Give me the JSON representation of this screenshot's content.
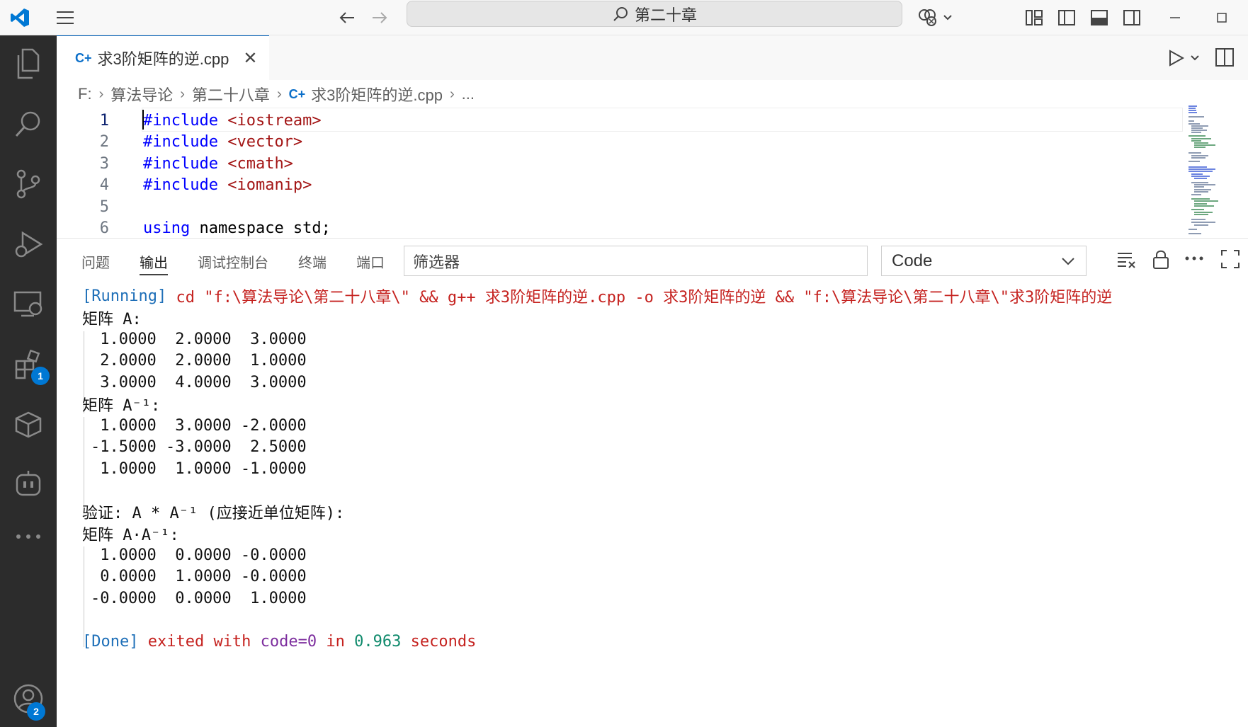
{
  "titlebar": {
    "search_text": "第二十章"
  },
  "tabs": {
    "active_file": "求3阶矩阵的逆.cpp",
    "close_glyph": "✕"
  },
  "breadcrumb": {
    "items": [
      "F:",
      "算法导论",
      "第二十八章",
      "求3阶矩阵的逆.cpp",
      "..."
    ]
  },
  "editor": {
    "lines": [
      {
        "num": "1",
        "kw": "#include",
        "rest": " <iostream>"
      },
      {
        "num": "2",
        "kw": "#include",
        "rest": " <vector>"
      },
      {
        "num": "3",
        "kw": "#include",
        "rest": " <cmath>"
      },
      {
        "num": "4",
        "kw": "#include",
        "rest": " <iomanip>"
      },
      {
        "num": "5",
        "kw": "",
        "rest": ""
      },
      {
        "num": "6",
        "kw": "using",
        "rest": " namespace std;"
      }
    ]
  },
  "activitybar": {
    "extensions_badge": "1",
    "accounts_badge": "2"
  },
  "panel": {
    "tabs": [
      "问题",
      "输出",
      "调试控制台",
      "终端",
      "端口"
    ],
    "active_tab": "输出",
    "filter_placeholder": "筛选器",
    "channel": "Code"
  },
  "output": {
    "running_tag": "[Running]",
    "running_cmd": " cd \"f:\\算法导论\\第二十八章\\\" && g++ 求3阶矩阵的逆.cpp -o 求3阶矩阵的逆 && \"f:\\算法导论\\第二十八章\\\"求3阶矩阵的逆",
    "matrix_a_title": "矩阵 A:",
    "matrix_a": [
      " 1.0000  2.0000  3.0000",
      " 2.0000  2.0000  1.0000",
      " 3.0000  4.0000  3.0000"
    ],
    "matrix_inv_title": "矩阵 A⁻¹:",
    "matrix_inv": [
      " 1.0000  3.0000 -2.0000",
      "-1.5000 -3.0000  2.5000",
      " 1.0000  1.0000 -1.0000"
    ],
    "verify_title": "验证: A * A⁻¹ (应接近单位矩阵):",
    "matrix_prod_title": "矩阵 A·A⁻¹:",
    "matrix_prod": [
      " 1.0000  0.0000 -0.0000",
      " 0.0000  1.0000 -0.0000",
      "-0.0000  0.0000  1.0000"
    ],
    "done_tag": "[Done]",
    "done_exited": " exited with ",
    "done_code": "code=0",
    "done_in": " in ",
    "done_time": "0.963",
    "done_seconds": " seconds"
  }
}
